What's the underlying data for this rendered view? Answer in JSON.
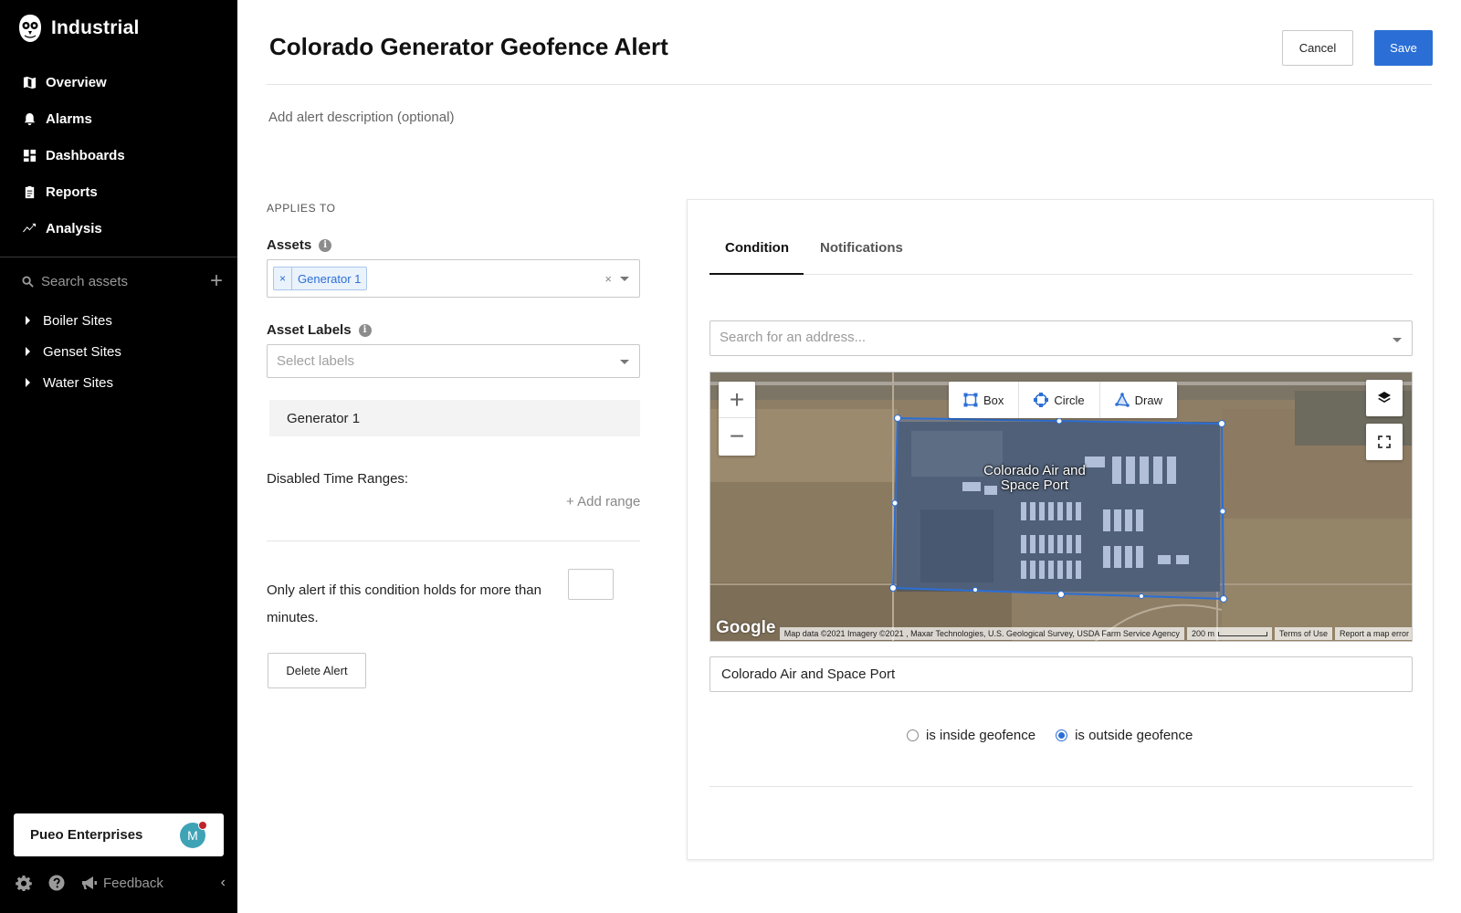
{
  "sidebar": {
    "brand": "Industrial",
    "nav": [
      {
        "label": "Overview",
        "icon": "map-icon"
      },
      {
        "label": "Alarms",
        "icon": "bell-icon"
      },
      {
        "label": "Dashboards",
        "icon": "dashboard-icon"
      },
      {
        "label": "Reports",
        "icon": "clipboard-icon"
      },
      {
        "label": "Analysis",
        "icon": "trend-icon"
      }
    ],
    "search_placeholder": "Search assets",
    "tree": [
      "Boiler Sites",
      "Genset Sites",
      "Water Sites"
    ],
    "org_name": "Pueo Enterprises",
    "avatar_initial": "M",
    "feedback_label": "Feedback"
  },
  "header": {
    "title": "Colorado Generator Geofence Alert",
    "cancel_label": "Cancel",
    "save_label": "Save",
    "description_placeholder": "Add alert description (optional)"
  },
  "applies_to": {
    "section_label": "APPLIES TO",
    "assets_label": "Assets",
    "selected_asset_chip": "Generator 1",
    "asset_labels_label": "Asset Labels",
    "asset_labels_placeholder": "Select labels",
    "asset_row": "Generator 1",
    "disabled_ranges_label": "Disabled Time Ranges:",
    "add_range_label": "+ Add range",
    "duration_text": "Only alert if this condition holds for more than minutes.",
    "duration_value": "",
    "delete_label": "Delete Alert"
  },
  "panel": {
    "tabs": [
      "Condition",
      "Notifications"
    ],
    "active_tab": "Condition",
    "address_placeholder": "Search for an address...",
    "map": {
      "tools": [
        "Box",
        "Circle",
        "Draw"
      ],
      "place_label": "Colorado Air and Space Port",
      "google": "Google",
      "attribution": "Map data ©2021 Imagery ©2021 , Maxar Technologies, U.S. Geological Survey, USDA Farm Service Agency",
      "scale": "200 m",
      "terms": "Terms of Use",
      "report": "Report a map error"
    },
    "place_value": "Colorado Air and Space Port",
    "radio_inside": "is inside geofence",
    "radio_outside": "is outside geofence",
    "selected_radio": "outside"
  },
  "colors": {
    "accent": "#2b6fd6",
    "sidebar_bg": "#000000",
    "notification_dot": "#c0232c",
    "avatar": "#3fa3b6"
  }
}
